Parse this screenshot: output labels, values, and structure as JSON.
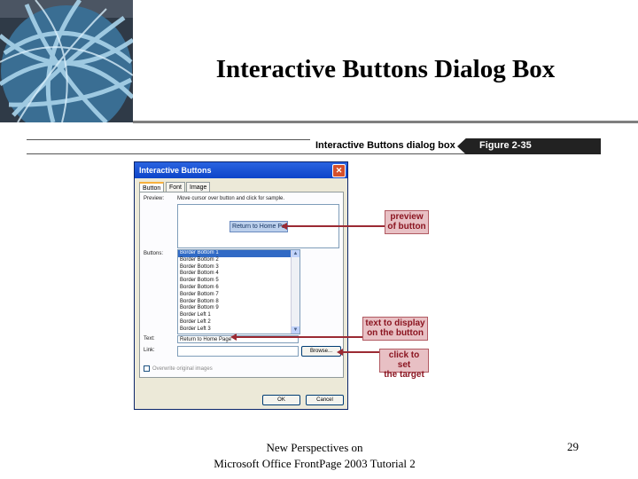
{
  "slide": {
    "title": "Interactive Buttons Dialog Box",
    "footer_line1": "New Perspectives on",
    "footer_line2": "Microsoft Office FrontPage 2003 Tutorial 2",
    "page_number": "29"
  },
  "figure": {
    "caption": "Interactive Buttons dialog box",
    "label": "Figure 2-35"
  },
  "dialog": {
    "title": "Interactive Buttons",
    "close": "✕",
    "tabs": [
      {
        "label": "Button",
        "active": true
      },
      {
        "label": "Font",
        "active": false
      },
      {
        "label": "Image",
        "active": false
      }
    ],
    "preview_label": "Preview:",
    "preview_hint": "Move cursor over button and click for sample.",
    "preview_button_text": "Return to Home Pa",
    "buttons_label": "Buttons:",
    "button_list": [
      "Border Bottom 1",
      "Border Bottom 2",
      "Border Bottom 3",
      "Border Bottom 4",
      "Border Bottom 5",
      "Border Bottom 6",
      "Border Bottom 7",
      "Border Bottom 8",
      "Border Bottom 9",
      "Border Left 1",
      "Border Left 2",
      "Border Left 3"
    ],
    "selected_index": 0,
    "text_label": "Text:",
    "text_value": "Return to Home Page",
    "link_label": "Link:",
    "link_value": "",
    "browse_label": "Browse...",
    "checkbox_label": "Overwrite original images",
    "ok_label": "OK",
    "cancel_label": "Cancel"
  },
  "callouts": {
    "preview": [
      "preview",
      "of button"
    ],
    "text": [
      "text to display",
      "on the button"
    ],
    "link": [
      "click to set",
      "the target"
    ]
  },
  "colors": {
    "callout_fill": "#e8c0c4",
    "callout_text": "#8b1521",
    "title_bar": "#0d45c9"
  }
}
